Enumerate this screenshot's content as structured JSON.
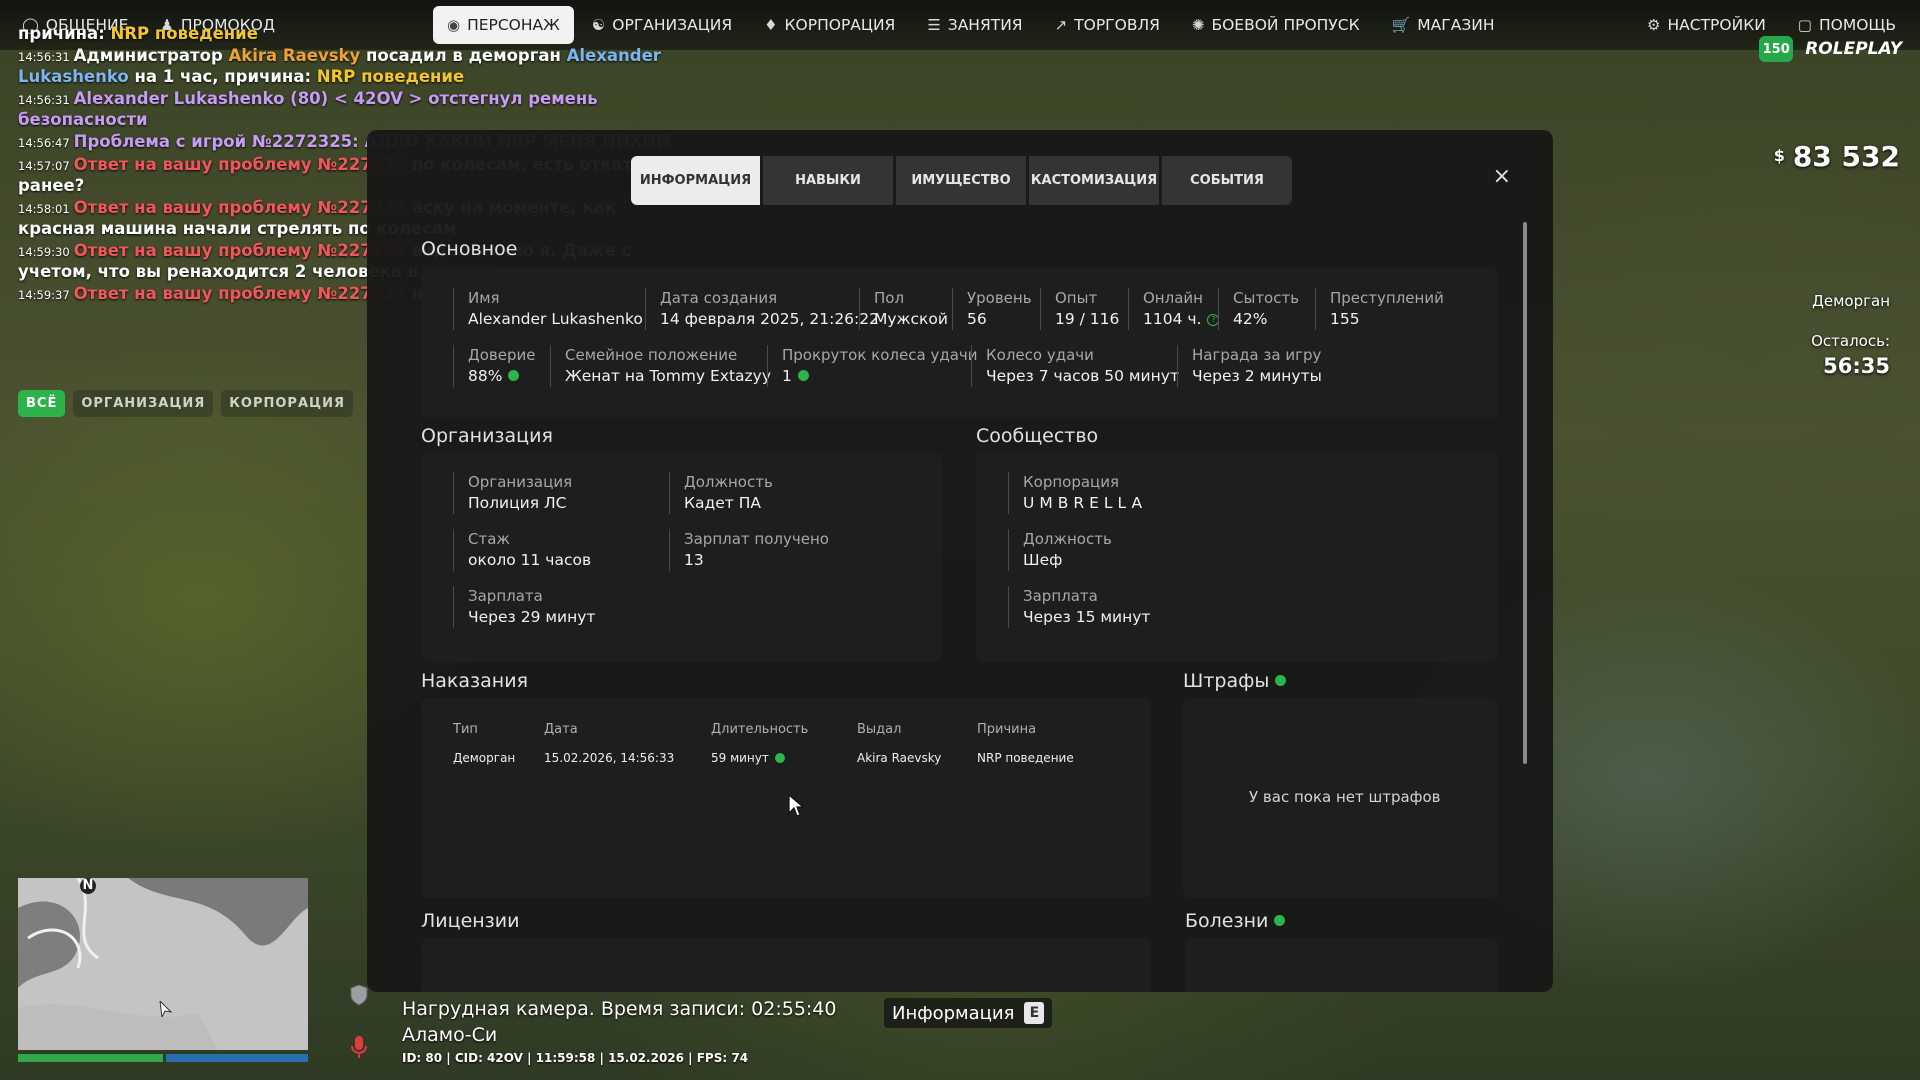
{
  "topnav": {
    "left": [
      {
        "label": "ОБЩЕНИЕ",
        "icon": "chat-icon"
      },
      {
        "label": "ПРОМОКОД",
        "icon": "person-icon"
      },
      {
        "label": "ПЕРСОНАЖ",
        "icon": "user-circle-icon",
        "active": true
      },
      {
        "label": "ОРГАНИЗАЦИЯ",
        "icon": "organization-icon"
      },
      {
        "label": "КОРПОРАЦИЯ",
        "icon": "corporation-icon"
      },
      {
        "label": "ЗАНЯТИЯ",
        "icon": "tasks-icon"
      },
      {
        "label": "ТОРГОВЛЯ",
        "icon": "trade-chart-icon"
      },
      {
        "label": "БОЕВОЙ ПРОПУСК",
        "icon": "battlepass-icon"
      },
      {
        "label": "МАГАЗИН",
        "icon": "cart-icon"
      }
    ],
    "right": [
      {
        "label": "НАСТРОЙКИ",
        "icon": "gear-icon"
      },
      {
        "label": "ПОМОЩЬ",
        "icon": "help-icon"
      }
    ]
  },
  "chat": {
    "top_fragment": {
      "prefix": "причина: ",
      "rest": "NRP поведение",
      "behind": "evsky посадил в"
    },
    "lines": [
      {
        "ts": "14:56:31",
        "parts": [
          {
            "t": "Администратор ",
            "c": "white"
          },
          {
            "t": "Akira Raevsky",
            "c": "orange"
          },
          {
            "t": " посадил в деморган ",
            "c": "white"
          },
          {
            "t": "Alexander Lukashenko",
            "c": "blue"
          },
          {
            "t": " на 1 час, причина: ",
            "c": "white"
          },
          {
            "t": "NRP поведение",
            "c": "yellow"
          }
        ]
      },
      {
        "ts": "14:56:31",
        "parts": [
          {
            "t": "Alexander Lukashenko (80) < 42OV > отстегнул ремень безопасности",
            "c": "purple"
          }
        ]
      },
      {
        "ts": "14:56:47",
        "parts": [
          {
            "t": "Проблема с игрой №2272325: АЛЛО КАКОЙ NRP МЕНЯ ПИХНИ",
            "c": "purple"
          }
        ]
      },
      {
        "ts": "14:57:07",
        "parts": [
          {
            "t": "Ответ на вашу проблему №227232",
            "c": "red"
          },
          {
            "t": " по колесам, есть откат ранее?",
            "c": "white"
          }
        ]
      },
      {
        "ts": "14:58:01",
        "parts": [
          {
            "t": "Ответ на вашу проблему №227232",
            "c": "red"
          },
          {
            "t": " аску на моменте, как красная машина ",
            "c": "white"
          },
          {
            "t": "начали стрелять по колесам",
            "c": "white"
          }
        ]
      },
      {
        "ts": "14:59:30",
        "parts": [
          {
            "t": "Ответ на вашу проблему №227232",
            "c": "red"
          },
          {
            "t": " видел лично я. Даже с учетом, что вы ре",
            "c": "white"
          },
          {
            "t": "находится 2 человека в машине",
            "c": "white"
          }
        ]
      },
      {
        "ts": "14:59:37",
        "parts": [
          {
            "t": "Ответ на вашу проблему №227232",
            "c": "red"
          },
          {
            "t": " на форум",
            "c": "white"
          }
        ]
      }
    ],
    "filters": [
      {
        "label": "ВСЁ",
        "active": true
      },
      {
        "label": "ОРГАНИЗАЦИЯ",
        "active": false
      },
      {
        "label": "КОРПОРАЦИЯ",
        "active": false
      }
    ]
  },
  "hud": {
    "currency": "$",
    "money": "83 532",
    "badge_value": "150",
    "brand": "ROLEPLAY",
    "status_title": "Деморган",
    "remaining_label": "Осталось:",
    "remaining_time": "56:35"
  },
  "modal": {
    "tabs": [
      {
        "label": "ИНФОРМАЦИЯ",
        "active": true
      },
      {
        "label": "НАВЫКИ"
      },
      {
        "label": "ИМУЩЕСТВО"
      },
      {
        "label": "КАСТОМИЗАЦИЯ"
      },
      {
        "label": "СОБЫТИЯ"
      }
    ],
    "close_label": "×",
    "basic": {
      "title": "Основное",
      "name_label": "Имя",
      "name": "Alexander Lukashenko",
      "created_label": "Дата создания",
      "created": "14 февраля 2025, 21:26:22",
      "gender_label": "Пол",
      "gender": "Мужской",
      "level_label": "Уровень",
      "level": "56",
      "exp_label": "Опыт",
      "exp": "19 / 116",
      "online_label": "Онлайн",
      "online": "1104 ч.",
      "satiety_label": "Сытость",
      "satiety": "42%",
      "crimes_label": "Преступлений",
      "crimes": "155",
      "trust_label": "Доверие",
      "trust": "88%",
      "family_label": "Семейное положение",
      "family": "Женат на Tommy Extazyy",
      "spins_label": "Прокруток колеса удачи",
      "spins": "1",
      "wheel_label": "Колесо удачи",
      "wheel": "Через 7 часов 50 минут",
      "reward_label": "Награда за игру",
      "reward": "Через 2 минуты"
    },
    "organization": {
      "title": "Организация",
      "org_label": "Организация",
      "org": "Полиция ЛС",
      "position_label": "Должность",
      "position": "Кадет ПА",
      "tenure_label": "Стаж",
      "tenure": "около 11 часов",
      "salaries_label": "Зарплат получено",
      "salaries": "13",
      "salary_label": "Зарплата",
      "salary": "Через 29 минут"
    },
    "community": {
      "title": "Сообщество",
      "corp_label": "Корпорация",
      "corp": "UMBRELLA",
      "position_label": "Должность",
      "position": "Шеф",
      "salary_label": "Зарплата",
      "salary": "Через 15 минут"
    },
    "punishments": {
      "title": "Наказания",
      "headers": {
        "type": "Тип",
        "date": "Дата",
        "duration": "Длительность",
        "issuer": "Выдал",
        "reason": "Причина"
      },
      "rows": [
        {
          "type": "Деморган",
          "date": "15.02.2026, 14:56:33",
          "duration": "59 минут",
          "issuer": "Akira Raevsky",
          "reason": "NRP поведение"
        }
      ]
    },
    "fines": {
      "title": "Штрафы",
      "empty": "У вас пока нет штрафов"
    },
    "licenses": {
      "title": "Лицензии"
    },
    "diseases": {
      "title": "Болезни"
    }
  },
  "bottom": {
    "minimap_north": "N",
    "bodycam": "Нагрудная камера. Время записи: 02:55:40",
    "location": "Аламо-Си",
    "meta": "ID: 80 | CID: 42OV | 11:59:58   | 15.02.2026 | FPS: 74",
    "info_label": "Информация",
    "info_key": "E",
    "health_fraction": 0.5
  },
  "colors": {
    "accent_green": "#2bb54b",
    "tab_active_bg": "#ececec",
    "chat_red": "#f0565c"
  }
}
